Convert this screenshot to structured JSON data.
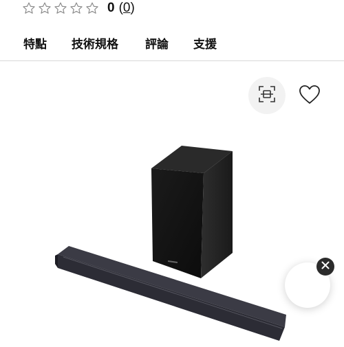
{
  "rating": {
    "stars_filled": 0,
    "stars_total": 5,
    "value": "0",
    "count_open": "(",
    "count": "0",
    "count_close": ")"
  },
  "tabs": [
    "特點",
    "技術規格",
    "評論",
    "支援"
  ],
  "icons": {
    "star": "star-outline-icon",
    "scan": "scan-icon",
    "wishlist": "heart-icon",
    "close": "close-icon"
  },
  "colors": {
    "star_outline": "#8a8a8a",
    "tab_divider": "#d8d8d8",
    "scan_button_bg": "#f2f2f2",
    "close_badge_bg": "#2b2b2b"
  }
}
